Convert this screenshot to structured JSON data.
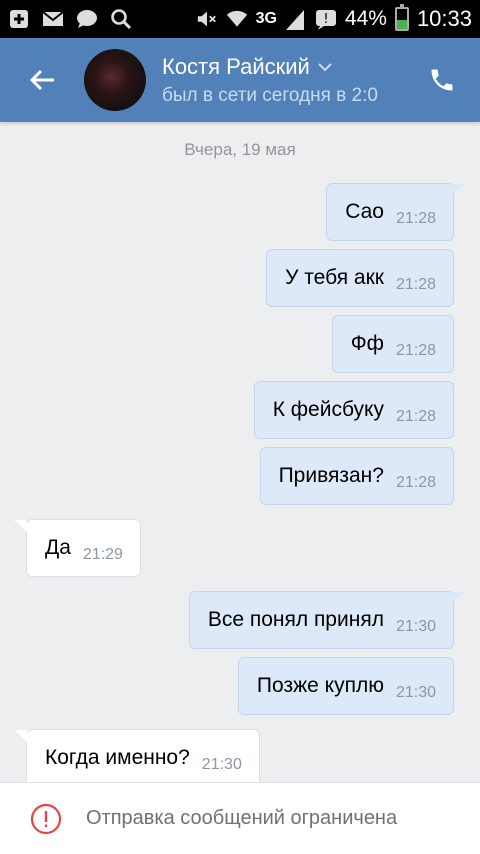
{
  "status_bar": {
    "network": "3G",
    "battery": "44%",
    "battery_level": 0.44,
    "time": "10:33",
    "icons": [
      "plus-square-icon",
      "mail-icon",
      "chat-bubble-icon",
      "search-icon",
      "mute-icon",
      "wifi-icon",
      "signal-icon",
      "notification-icon",
      "battery-icon"
    ]
  },
  "header": {
    "name": "Костя Райский",
    "status": "был в сети сегодня в 2:0",
    "colors": {
      "bar": "#5181b8",
      "status_text": "#c9dbef"
    }
  },
  "date_separator": "Вчера, 19 мая",
  "messages": [
    {
      "text": "Сао",
      "time": "21:28",
      "direction": "out"
    },
    {
      "text": "У тебя акк",
      "time": "21:28",
      "direction": "out"
    },
    {
      "text": "Фф",
      "time": "21:28",
      "direction": "out"
    },
    {
      "text": "К фейсбуку",
      "time": "21:28",
      "direction": "out"
    },
    {
      "text": "Привязан?",
      "time": "21:28",
      "direction": "out"
    },
    {
      "text": "Да",
      "time": "21:29",
      "direction": "in"
    },
    {
      "text": "Все понял принял",
      "time": "21:30",
      "direction": "out"
    },
    {
      "text": "Позже куплю",
      "time": "21:30",
      "direction": "out"
    },
    {
      "text": "Когда именно?",
      "time": "21:30",
      "direction": "in"
    }
  ],
  "bottom_bar": {
    "text": "Отправка сообщений ограничена",
    "icon": "warning-circle-icon",
    "icon_color": "#e64646"
  },
  "colors": {
    "outgoing_bubble": "#dde9f8",
    "incoming_bubble": "#ffffff",
    "background": "#edeef0"
  }
}
